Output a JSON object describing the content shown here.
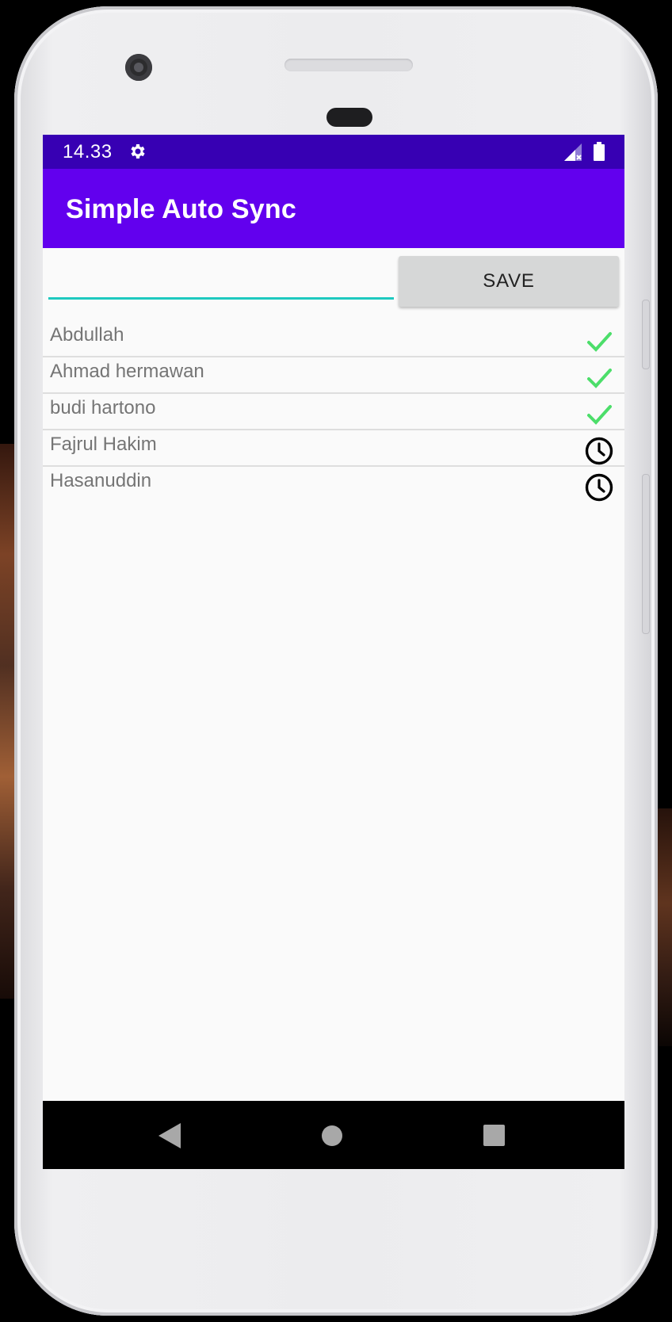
{
  "status_bar": {
    "time": "14.33",
    "icons": [
      "settings-gear-icon",
      "no-sim-signal-icon",
      "battery-icon"
    ]
  },
  "app_bar": {
    "title": "Simple Auto Sync"
  },
  "entry": {
    "input_value": "",
    "input_placeholder": "",
    "save_label": "SAVE"
  },
  "colors": {
    "status_bar": "#3700b3",
    "app_bar": "#6200ee",
    "input_underline": "#1ec9c0",
    "synced_check": "#4cde6a",
    "pending_clock": "#000000"
  },
  "list": {
    "items": [
      {
        "name": "Abdullah",
        "status": "synced",
        "icon": "check-icon"
      },
      {
        "name": "Ahmad hermawan",
        "status": "synced",
        "icon": "check-icon"
      },
      {
        "name": "budi hartono",
        "status": "synced",
        "icon": "check-icon"
      },
      {
        "name": "Fajrul Hakim",
        "status": "pending",
        "icon": "clock-icon"
      },
      {
        "name": "Hasanuddin",
        "status": "pending",
        "icon": "clock-icon"
      }
    ]
  },
  "nav_bar": {
    "icons": [
      "back-triangle-icon",
      "home-circle-icon",
      "recents-square-icon"
    ]
  }
}
